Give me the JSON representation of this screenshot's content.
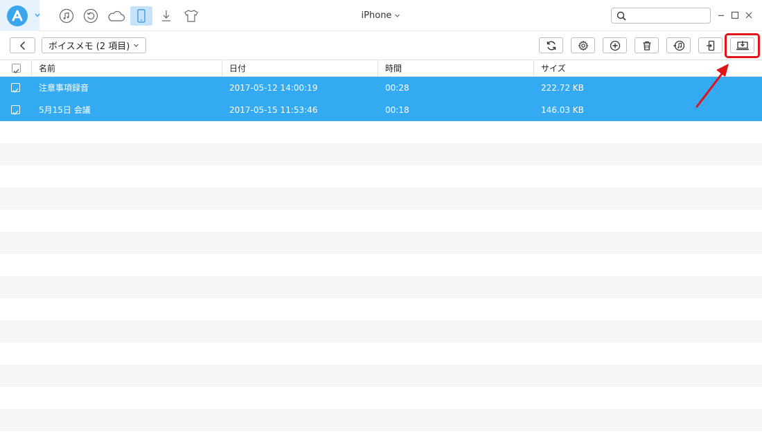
{
  "titlebar": {
    "device_name": "iPhone",
    "search_placeholder": ""
  },
  "nav_icons": [
    "music-icon",
    "restore-icon",
    "cloud-icon",
    "phone-icon",
    "download-icon",
    "tshirt-icon"
  ],
  "toolbar": {
    "folder_label": "ボイスメモ (2 項目)",
    "buttons": [
      "refresh-icon",
      "settings-icon",
      "add-icon",
      "delete-icon",
      "to-itunes-icon",
      "to-device-icon",
      "to-computer-icon"
    ]
  },
  "table": {
    "columns": [
      "名前",
      "日付",
      "時間",
      "サイズ"
    ],
    "rows": [
      {
        "name": "注意事項録音",
        "date": "2017-05-12 14:00:19",
        "duration": "00:28",
        "size": "222.72 KB",
        "checked": true
      },
      {
        "name": "5月15日 会議",
        "date": "2017-05-15 11:53:46",
        "duration": "00:18",
        "size": "146.03 KB",
        "checked": true
      }
    ]
  },
  "colors": {
    "accent": "#33aaf2",
    "highlight": "#e0141a",
    "stripe": "#f6f6f6"
  }
}
